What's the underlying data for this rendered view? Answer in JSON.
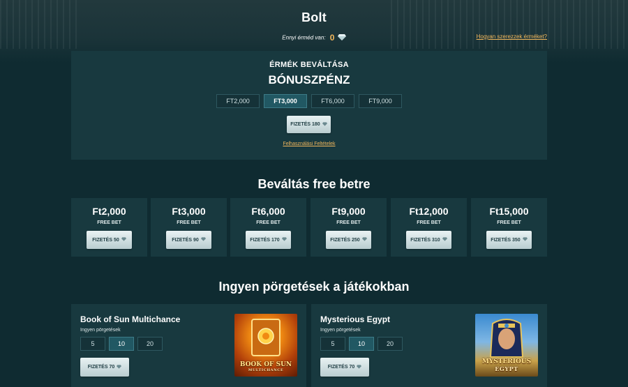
{
  "page": {
    "title": "Bolt",
    "coins": {
      "label": "Ennyi érméd van:",
      "value": "0",
      "icon": "diamond-icon"
    },
    "how_link": "Hogyan szerezzek érméket?"
  },
  "bonus": {
    "subtitle": "ÉRMÉK BEVÁLTÁSA",
    "title": "BÓNUSZPÉNZ",
    "amounts": [
      "FT2,000",
      "FT3,000",
      "FT6,000",
      "FT9,000"
    ],
    "selected": "FT3,000",
    "pay_label": "FIZETÉS 180",
    "terms_link": "Felhasználási Feltételek"
  },
  "freebet": {
    "title": "Beváltás free betre",
    "cards": [
      {
        "amount": "Ft2,000",
        "label": "FREE BET",
        "pay": "FIZETÉS 50"
      },
      {
        "amount": "Ft3,000",
        "label": "FREE BET",
        "pay": "FIZETÉS 90"
      },
      {
        "amount": "Ft6,000",
        "label": "FREE BET",
        "pay": "FIZETÉS 170"
      },
      {
        "amount": "Ft9,000",
        "label": "FREE BET",
        "pay": "FIZETÉS 250"
      },
      {
        "amount": "Ft12,000",
        "label": "FREE BET",
        "pay": "FIZETÉS 310"
      },
      {
        "amount": "Ft15,000",
        "label": "FREE BET",
        "pay": "FIZETÉS 350"
      }
    ]
  },
  "freespins": {
    "title": "Ingyen pörgetések a játékokban",
    "games": [
      {
        "name": "Book of Sun Multichance",
        "sub": "Ingyen pörgetések",
        "options": [
          "5",
          "10",
          "20"
        ],
        "selected": "10",
        "pay": "FIZETÉS 70",
        "thumb_title": "BOOK OF SUN",
        "thumb_sub": "MULTICHANCE"
      },
      {
        "name": "Mysterious Egypt",
        "sub": "Ingyen pörgetések",
        "options": [
          "5",
          "10",
          "20"
        ],
        "selected": "10",
        "pay": "FIZETÉS 70",
        "thumb_title": "MYSTERIOUS",
        "thumb_sub": "EGYPT"
      }
    ]
  },
  "colors": {
    "background": "#0f2b31",
    "panel": "#18393f",
    "accent": "#f3b85c",
    "active": "#215863"
  }
}
